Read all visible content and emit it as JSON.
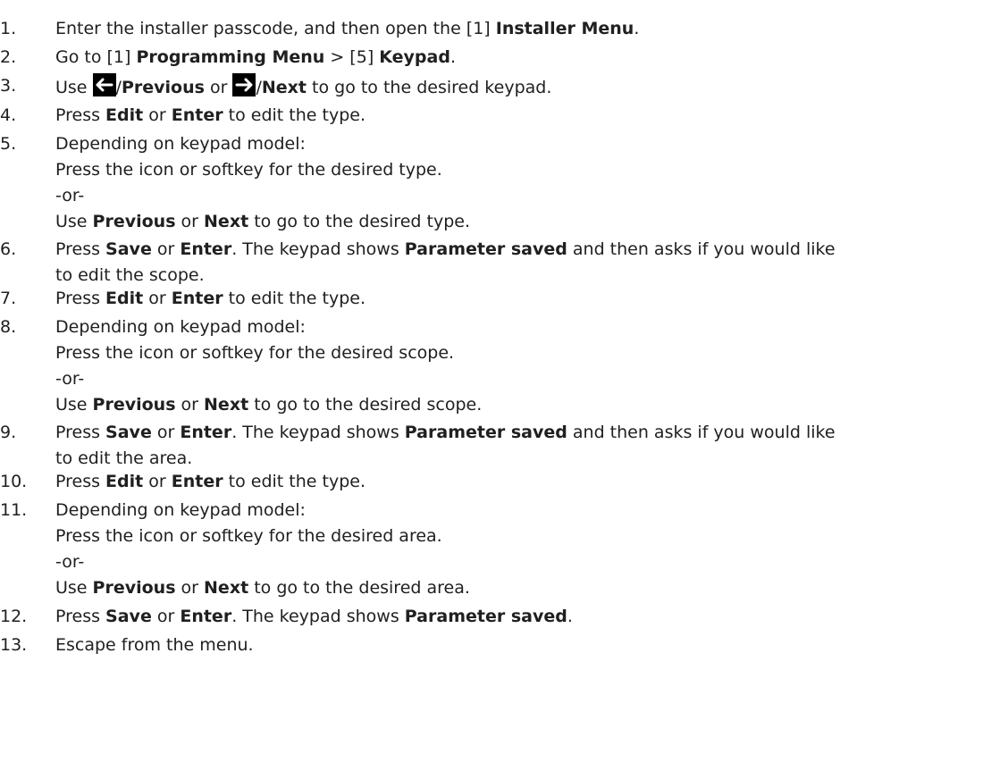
{
  "steps": [
    {
      "num": "1.",
      "lines": [
        [
          {
            "t": "Enter the installer passcode, and then open the [1] "
          },
          {
            "t": "Installer Menu",
            "b": true
          },
          {
            "t": "."
          }
        ]
      ]
    },
    {
      "num": "2.",
      "lines": [
        [
          {
            "t": "Go to [1] "
          },
          {
            "t": "Programming Menu",
            "b": true
          },
          {
            "t": " > [5] "
          },
          {
            "t": "Keypad",
            "b": true
          },
          {
            "t": "."
          }
        ]
      ]
    },
    {
      "num": "3.",
      "lines": [
        [
          {
            "t": "Use "
          },
          {
            "icon": "left-arrow-icon"
          },
          {
            "t": "/"
          },
          {
            "t": "Previous",
            "b": true
          },
          {
            "t": " or "
          },
          {
            "icon": "right-arrow-icon"
          },
          {
            "t": "/"
          },
          {
            "t": "Next",
            "b": true
          },
          {
            "t": " to go to the desired keypad."
          }
        ]
      ]
    },
    {
      "num": "4.",
      "lines": [
        [
          {
            "t": "Press "
          },
          {
            "t": "Edit",
            "b": true
          },
          {
            "t": " or "
          },
          {
            "t": "Enter",
            "b": true
          },
          {
            "t": " to edit the type."
          }
        ]
      ]
    },
    {
      "num": "5.",
      "lines": [
        [
          {
            "t": "Depending on keypad model:"
          }
        ],
        [
          {
            "t": "Press the icon or softkey for the desired type."
          }
        ],
        [
          {
            "t": "-or-"
          }
        ],
        [
          {
            "t": "Use "
          },
          {
            "t": "Previous",
            "b": true
          },
          {
            "t": " or "
          },
          {
            "t": "Next",
            "b": true
          },
          {
            "t": " to go to the desired type."
          }
        ]
      ]
    },
    {
      "num": "6.",
      "lines": [
        [
          {
            "t": "Press "
          },
          {
            "t": "Save",
            "b": true
          },
          {
            "t": " or "
          },
          {
            "t": "Enter",
            "b": true
          },
          {
            "t": ". The keypad shows "
          },
          {
            "t": "Parameter saved",
            "b": true
          },
          {
            "t": " and then asks if you would like"
          }
        ],
        [
          {
            "t": "to edit the scope."
          }
        ]
      ]
    },
    {
      "num": "7.",
      "lines": [
        [
          {
            "t": "Press "
          },
          {
            "t": "Edit",
            "b": true
          },
          {
            "t": " or "
          },
          {
            "t": "Enter",
            "b": true
          },
          {
            "t": " to edit the type."
          }
        ]
      ]
    },
    {
      "num": "8.",
      "lines": [
        [
          {
            "t": "Depending on keypad model:"
          }
        ],
        [
          {
            "t": "Press the icon or softkey for the desired scope."
          }
        ],
        [
          {
            "t": "-or-"
          }
        ],
        [
          {
            "t": "Use "
          },
          {
            "t": "Previous",
            "b": true
          },
          {
            "t": " or "
          },
          {
            "t": "Next",
            "b": true
          },
          {
            "t": " to go to the desired scope."
          }
        ]
      ]
    },
    {
      "num": "9.",
      "lines": [
        [
          {
            "t": "Press "
          },
          {
            "t": "Save",
            "b": true
          },
          {
            "t": " or "
          },
          {
            "t": "Enter",
            "b": true
          },
          {
            "t": ". The keypad shows "
          },
          {
            "t": "Parameter saved",
            "b": true
          },
          {
            "t": " and then asks if you would like"
          }
        ],
        [
          {
            "t": "to edit the area."
          }
        ]
      ]
    },
    {
      "num": "10.",
      "lines": [
        [
          {
            "t": "Press "
          },
          {
            "t": "Edit",
            "b": true
          },
          {
            "t": " or "
          },
          {
            "t": "Enter",
            "b": true
          },
          {
            "t": " to edit the type."
          }
        ]
      ]
    },
    {
      "num": "11.",
      "lines": [
        [
          {
            "t": "Depending on keypad model:"
          }
        ],
        [
          {
            "t": "Press the icon or softkey for the desired area."
          }
        ],
        [
          {
            "t": "-or-"
          }
        ],
        [
          {
            "t": "Use "
          },
          {
            "t": "Previous",
            "b": true
          },
          {
            "t": " or "
          },
          {
            "t": "Next",
            "b": true
          },
          {
            "t": " to go to the desired area."
          }
        ]
      ]
    },
    {
      "num": "12.",
      "lines": [
        [
          {
            "t": "Press "
          },
          {
            "t": "Save",
            "b": true
          },
          {
            "t": " or "
          },
          {
            "t": "Enter",
            "b": true
          },
          {
            "t": ". The keypad shows "
          },
          {
            "t": "Parameter saved",
            "b": true
          },
          {
            "t": "."
          }
        ]
      ]
    },
    {
      "num": "13.",
      "lines": [
        [
          {
            "t": "Escape from the menu."
          }
        ]
      ]
    }
  ]
}
